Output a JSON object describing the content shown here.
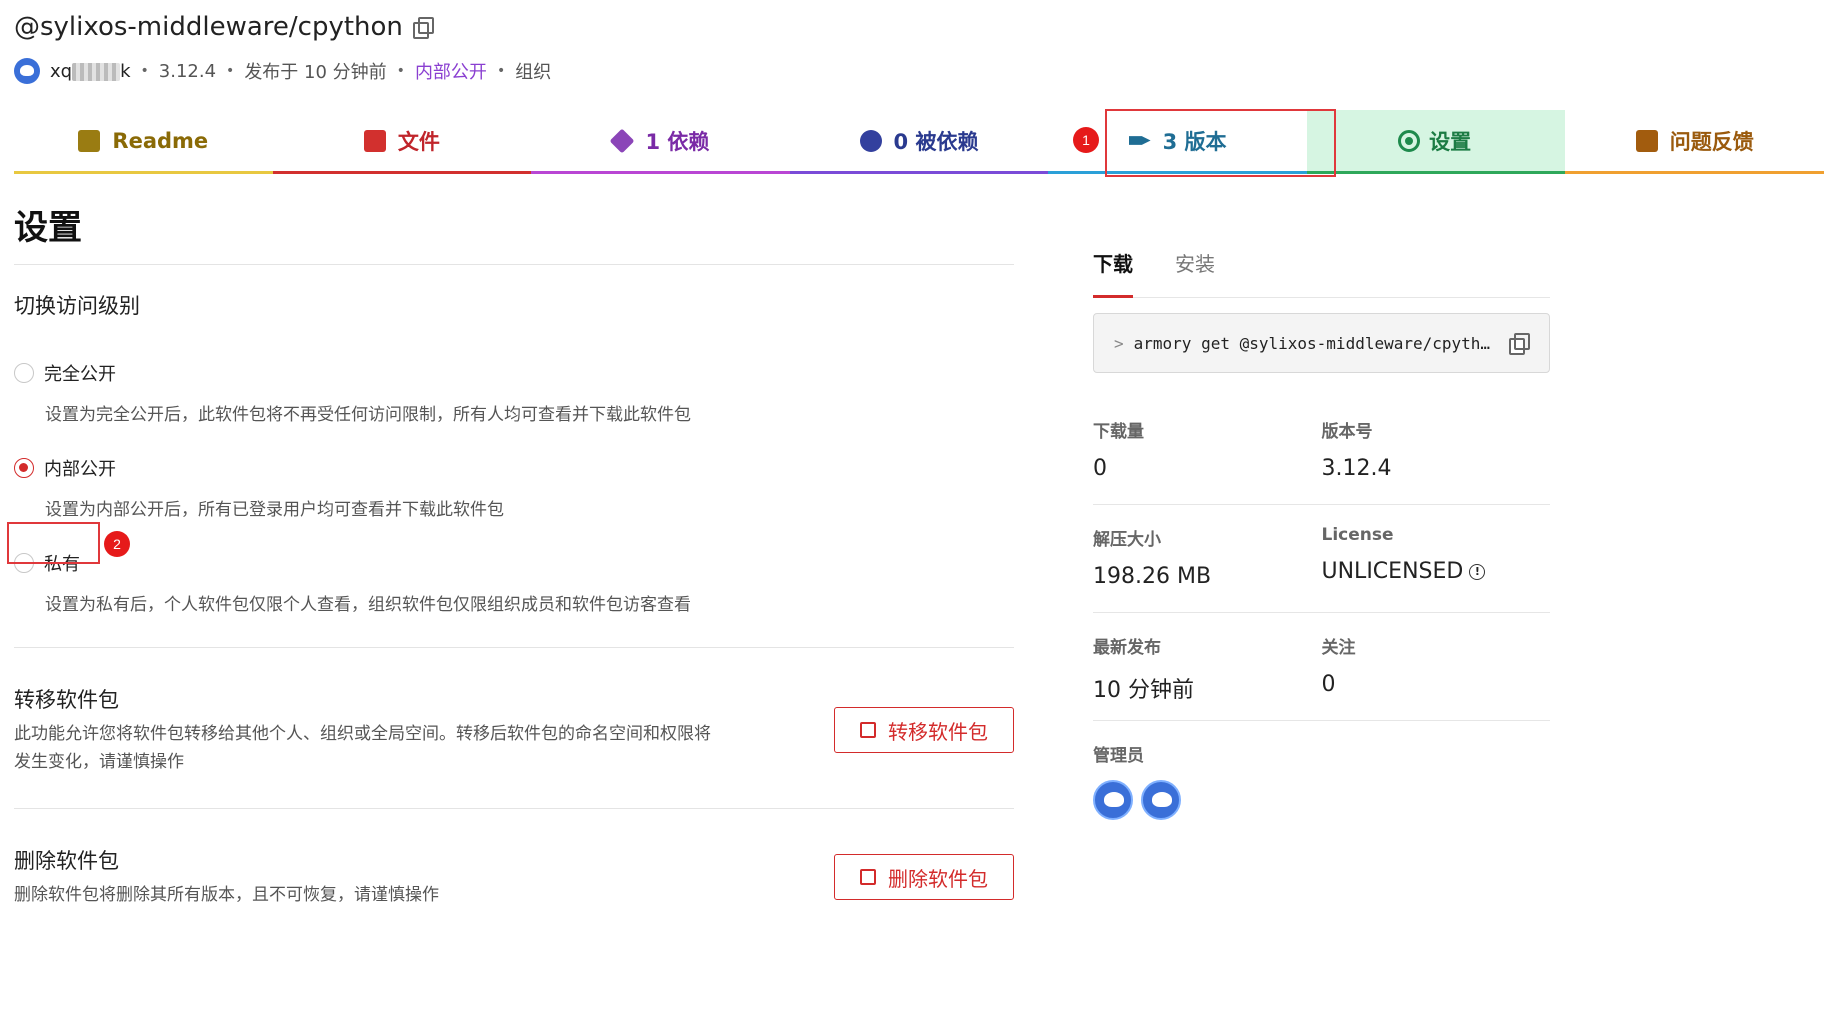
{
  "header": {
    "title": "@sylixos-middleware/cpython",
    "user": "xq",
    "user_suffix": "k",
    "version": "3.12.4",
    "published": "发布于 10 分钟前",
    "visibility": "内部公开",
    "type": "组织"
  },
  "tabs": [
    {
      "label": "Readme",
      "icon": "readme-icon"
    },
    {
      "label": "文件",
      "icon": "file-code-icon"
    },
    {
      "label": "1 依赖",
      "icon": "cube-icon"
    },
    {
      "label": "0 被依赖",
      "icon": "cubes-icon"
    },
    {
      "label": "3 版本",
      "icon": "tags-icon"
    },
    {
      "label": "设置",
      "icon": "gear-icon",
      "active": true
    },
    {
      "label": "问题反馈",
      "icon": "file-code-icon"
    }
  ],
  "annotations": {
    "badge1": "1",
    "badge2": "2"
  },
  "main": {
    "title": "设置",
    "access_section": "切换访问级别",
    "options": [
      {
        "label": "完全公开",
        "desc": "设置为完全公开后，此软件包将不再受任何访问限制，所有人均可查看并下载此软件包",
        "checked": false
      },
      {
        "label": "内部公开",
        "desc": "设置为内部公开后，所有已登录用户均可查看并下载此软件包",
        "checked": true
      },
      {
        "label": "私有",
        "desc": "设置为私有后，个人软件包仅限个人查看，组织软件包仅限组织成员和软件包访客查看",
        "checked": false
      }
    ],
    "transfer": {
      "title": "转移软件包",
      "desc": "此功能允许您将软件包转移给其他个人、组织或全局空间。转移后软件包的命名空间和权限将发生变化，请谨慎操作",
      "button": "转移软件包"
    },
    "delete": {
      "title": "删除软件包",
      "desc": "删除软件包将删除其所有版本，且不可恢复，请谨慎操作",
      "button": "删除软件包"
    }
  },
  "side": {
    "tabs": [
      "下载",
      "安装"
    ],
    "command": "armory get @sylixos-middleware/cpyth…",
    "prompt": ">",
    "stats": {
      "downloads_label": "下载量",
      "downloads": "0",
      "version_label": "版本号",
      "version": "3.12.4",
      "size_label": "解压大小",
      "size": "198.26 MB",
      "license_label": "License",
      "license": "UNLICENSED",
      "latest_label": "最新发布",
      "latest": "10 分钟前",
      "follow_label": "关注",
      "follow": "0",
      "admins_label": "管理员"
    }
  },
  "colors": {
    "accent": "#d32b2b",
    "settings_bg": "#d6f5e2",
    "purple": "#8a3fd1"
  }
}
